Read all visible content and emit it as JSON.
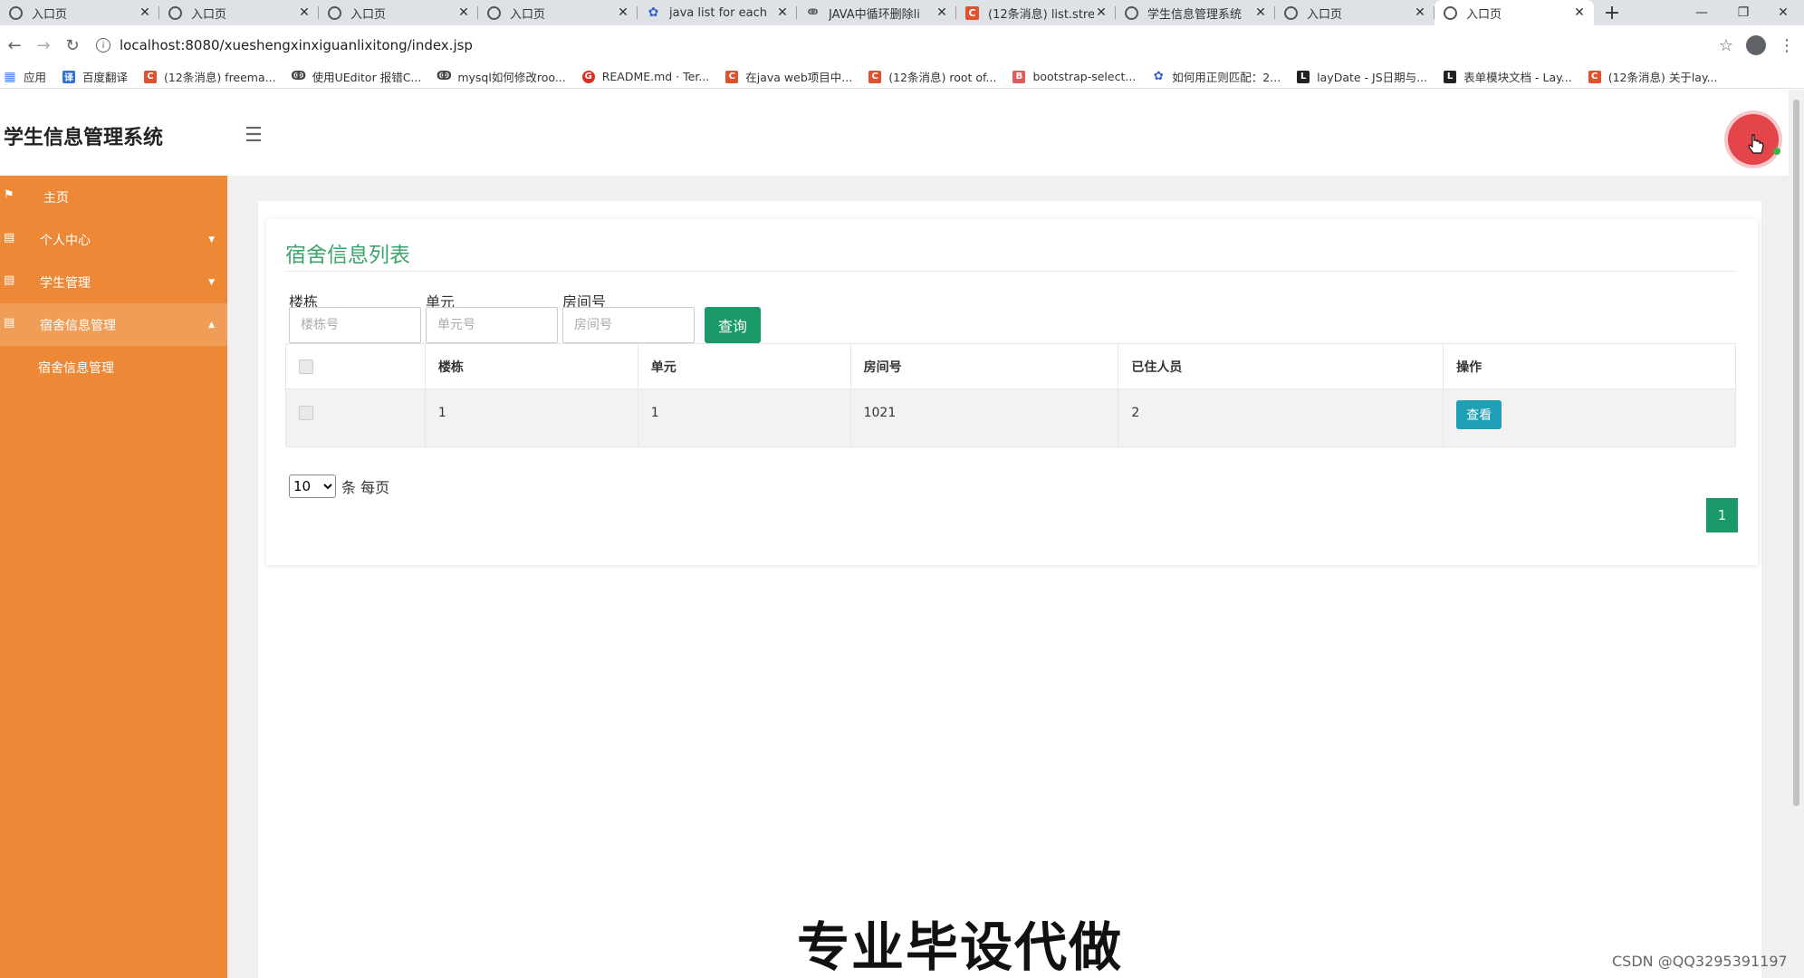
{
  "browser": {
    "tabs": [
      {
        "title": "入口页",
        "icon": "globe"
      },
      {
        "title": "入口页",
        "icon": "globe"
      },
      {
        "title": "入口页",
        "icon": "globe"
      },
      {
        "title": "入口页",
        "icon": "globe"
      },
      {
        "title": "java list for each",
        "icon": "baidu-paw"
      },
      {
        "title": "JAVA中循环删除li",
        "icon": "feather"
      },
      {
        "title": "(12条消息) list.stre",
        "icon": "csdn-c"
      },
      {
        "title": "学生信息管理系统",
        "icon": "globe"
      },
      {
        "title": "入口页",
        "icon": "globe"
      },
      {
        "title": "入口页",
        "icon": "globe",
        "active": true
      }
    ],
    "url": "localhost:8080/xueshengxinxiguanlixitong/index.jsp",
    "bookmarks": [
      {
        "label": "应用",
        "icon": "apps"
      },
      {
        "label": "百度翻译",
        "icon": "fanyi"
      },
      {
        "label": "(12条消息) freema...",
        "icon": "csdn-c"
      },
      {
        "label": "使用UEditor 报错C...",
        "icon": "feather"
      },
      {
        "label": "mysql如何修改roo...",
        "icon": "feather"
      },
      {
        "label": "README.md · Ter...",
        "icon": "gitee-g"
      },
      {
        "label": "在java web项目中...",
        "icon": "csdn-c"
      },
      {
        "label": "(12条消息) root of...",
        "icon": "csdn-c"
      },
      {
        "label": "bootstrap-select...",
        "icon": "bootstrap"
      },
      {
        "label": "如何用正则匹配：2...",
        "icon": "baidu-paw"
      },
      {
        "label": "layDate - JS日期与...",
        "icon": "layui"
      },
      {
        "label": "表单模块文档 - Lay...",
        "icon": "layui"
      },
      {
        "label": "(12条消息) 关于lay...",
        "icon": "csdn-c"
      }
    ]
  },
  "app": {
    "brand": "学生信息管理系统",
    "sidebar": [
      {
        "label": "主页",
        "icon": "flag-icon"
      },
      {
        "label": "个人中心",
        "icon": "grid-icon",
        "caret": "▼"
      },
      {
        "label": "学生管理",
        "icon": "grid-icon",
        "caret": "▼"
      },
      {
        "label": "宿舍信息管理",
        "icon": "grid-icon",
        "caret": "▲",
        "open": true
      }
    ],
    "sidebar_sub": [
      "宿舍信息管理"
    ],
    "card_title": "宿舍信息列表",
    "filters": [
      {
        "label": "楼栋",
        "placeholder": "楼栋号"
      },
      {
        "label": "单元",
        "placeholder": "单元号"
      },
      {
        "label": "房间号",
        "placeholder": "房间号"
      }
    ],
    "query_label": "查询",
    "table": {
      "columns": [
        "楼栋",
        "单元",
        "房间号",
        "已住人员",
        "操作"
      ],
      "rows": [
        {
          "building": "1",
          "unit": "1",
          "room": "1021",
          "residents": "2",
          "action": "查看"
        }
      ]
    },
    "page_size": "10",
    "page_size_suffix": "条 每页",
    "current_page": "1"
  },
  "overlay": {
    "watermark": "专业毕设代做",
    "csdn": "CSDN @QQ3295391197"
  },
  "colors": {
    "sidebar": "#ed8936",
    "accent_green": "#1a9a68",
    "title_green": "#3aa46a",
    "view_button": "#1e9fb5"
  }
}
